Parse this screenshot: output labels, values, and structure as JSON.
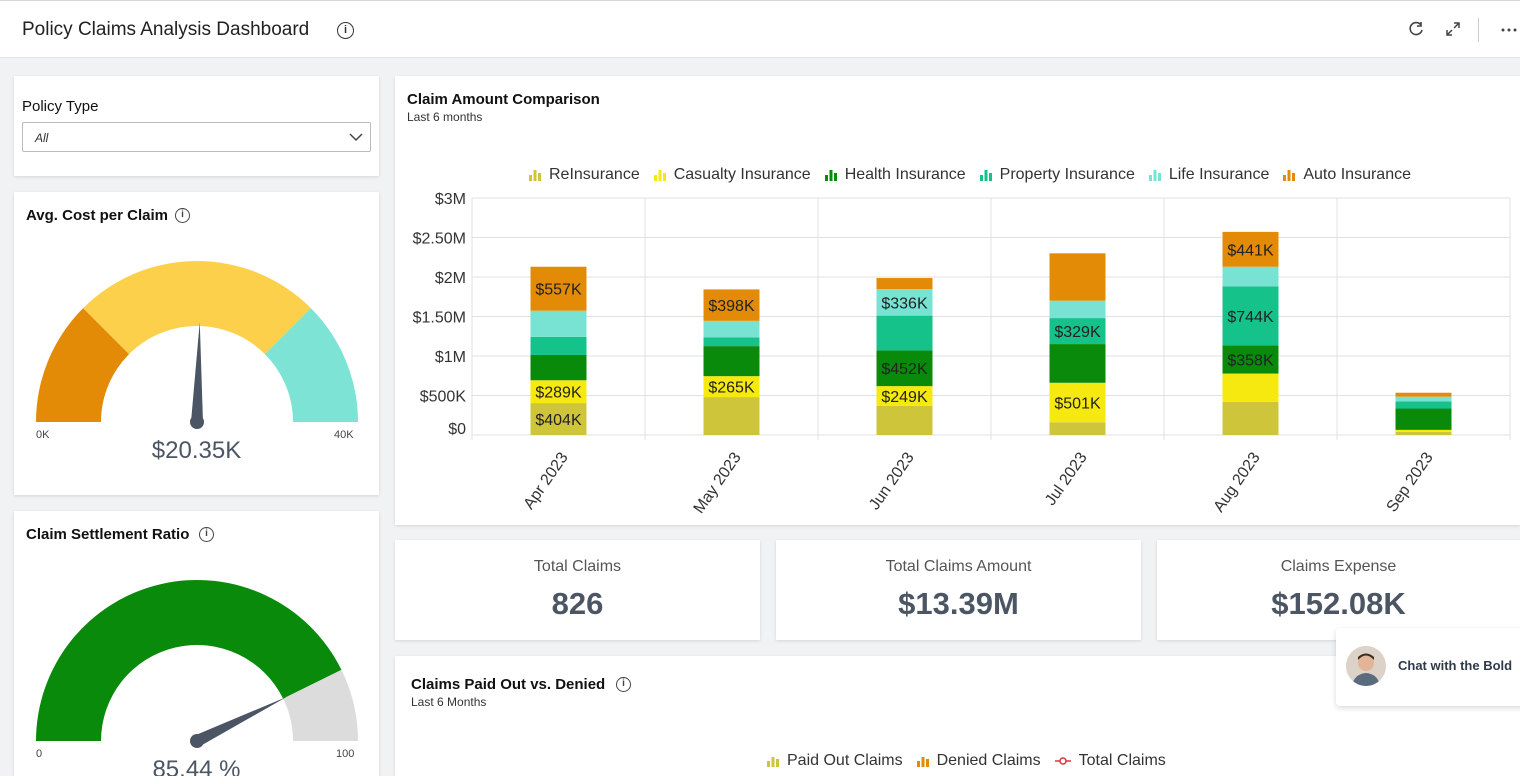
{
  "header": {
    "title": "Policy Claims Analysis Dashboard"
  },
  "filter": {
    "label": "Policy Type",
    "value": "All"
  },
  "avg_cost_gauge": {
    "title": "Avg. Cost per Claim",
    "min_label": "0K",
    "max_label": "40K",
    "value_label": "$20.35K",
    "value": 20.35,
    "min": 0,
    "max": 40,
    "colors": [
      "#e38b06",
      "#fcd04b",
      "#7de3d4"
    ]
  },
  "settlement_gauge": {
    "title": "Claim Settlement Ratio",
    "min_label": "0",
    "max_label": "100",
    "value_label": "85.44 %",
    "value": 85.44,
    "min": 0,
    "max": 100,
    "colors": [
      "#0a8a0a",
      "#dcdcdc"
    ]
  },
  "claim_chart": {
    "title": "Claim Amount Comparison",
    "subtitle": "Last 6 months",
    "chart_data": {
      "type": "bar",
      "stacked": true,
      "categories": [
        "Apr 2023",
        "May 2023",
        "Jun 2023",
        "Jul 2023",
        "Aug 2023",
        "Sep 2023"
      ],
      "y_ticks": [
        "$0",
        "$500K",
        "$1M",
        "$1.50M",
        "$2M",
        "$2.50M",
        "$3M"
      ],
      "ylim": [
        0,
        3000000
      ],
      "legend_position": "top",
      "series": [
        {
          "name": "ReInsurance",
          "color": "#cfc53a",
          "values": [
            404000,
            480000,
            370000,
            160000,
            420000,
            40000
          ],
          "labels": [
            "$404K",
            "",
            "",
            "",
            "",
            ""
          ]
        },
        {
          "name": "Casualty Insurance",
          "color": "#f5e90f",
          "values": [
            289000,
            265000,
            249000,
            501000,
            358000,
            25000
          ],
          "labels": [
            "$289K",
            "$265K",
            "$249K",
            "$501K",
            "",
            ""
          ]
        },
        {
          "name": "Health Insurance",
          "color": "#0a8a0a",
          "values": [
            320000,
            380000,
            452000,
            490000,
            358000,
            270000
          ],
          "labels": [
            "",
            "",
            "$452K",
            "",
            "$358K",
            ""
          ]
        },
        {
          "name": "Property Insurance",
          "color": "#15c289",
          "values": [
            230000,
            110000,
            440000,
            329000,
            744000,
            90000
          ],
          "labels": [
            "",
            "",
            "",
            "$329K",
            "$744K",
            ""
          ]
        },
        {
          "name": "Life Insurance",
          "color": "#79e3d3",
          "values": [
            330000,
            210000,
            336000,
            220000,
            250000,
            60000
          ],
          "labels": [
            "",
            "",
            "$336K",
            "",
            "",
            ""
          ]
        },
        {
          "name": "Auto Insurance",
          "color": "#e38b06",
          "values": [
            557000,
            398000,
            140000,
            600000,
            441000,
            50000
          ],
          "labels": [
            "$557K",
            "$398K",
            "",
            "",
            "$441K",
            ""
          ]
        }
      ]
    }
  },
  "kpis": [
    {
      "label": "Total Claims",
      "value": "826"
    },
    {
      "label": "Total Claims Amount",
      "value": "$13.39M"
    },
    {
      "label": "Claims Expense",
      "value": "$152.08K"
    }
  ],
  "paid_chart": {
    "title": "Claims Paid Out vs. Denied",
    "subtitle": "Last 6 Months",
    "legend": [
      {
        "name": "Paid Out Claims",
        "color": "#cfc53a",
        "icon": "bar-icon"
      },
      {
        "name": "Denied Claims",
        "color": "#e38b06",
        "icon": "bar-icon"
      },
      {
        "name": "Total Claims",
        "color": "#d9333a",
        "icon": "line-marker-icon"
      }
    ]
  },
  "chat": {
    "label": "Chat with the Bold"
  }
}
